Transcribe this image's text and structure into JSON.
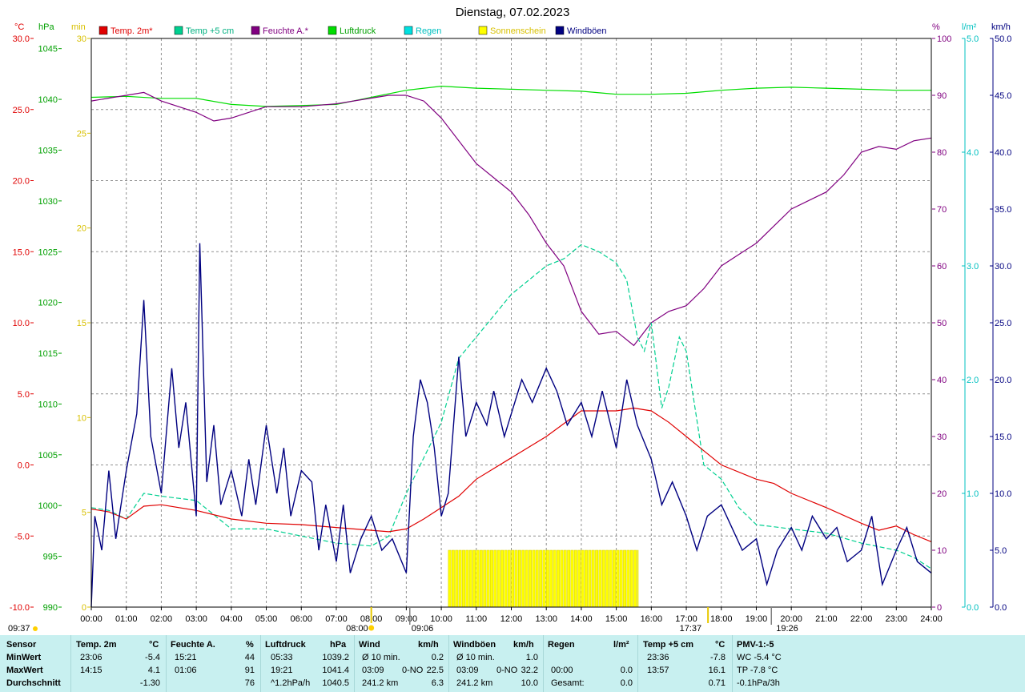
{
  "title": "Dienstag, 07.02.2023",
  "colors": {
    "temp": "#e00000",
    "temp5": "#00d090",
    "humidity": "#800080",
    "pressure": "#00dd00",
    "rain": "#00e0e0",
    "sun": "#ffff00",
    "gust": "#000080",
    "grid": "#808080"
  },
  "legend": [
    {
      "label": "Temp. 2m*",
      "color": "#e00000",
      "text_color": "#e00000"
    },
    {
      "label": "Temp +5 cm",
      "color": "#00d090",
      "text_color": "#00b080"
    },
    {
      "label": "Feuchte A.*",
      "color": "#800080",
      "text_color": "#800080"
    },
    {
      "label": "Luftdruck",
      "color": "#00dd00",
      "text_color": "#00a000"
    },
    {
      "label": "Regen",
      "color": "#00e0e0",
      "text_color": "#00c0c0"
    },
    {
      "label": "Sonnenschein",
      "color": "#ffff00",
      "text_color": "#d8c000"
    },
    {
      "label": "Windböen",
      "color": "#000080",
      "text_color": "#000080"
    }
  ],
  "axis_units": {
    "temp": "°C",
    "pressure": "hPa",
    "sun": "min",
    "humidity": "%",
    "rain": "l/m²",
    "wind": "km/h"
  },
  "chart_data": {
    "type": "line",
    "x_unit": "hours",
    "x_ticks": [
      "00:00",
      "01:00",
      "02:00",
      "03:00",
      "04:00",
      "05:00",
      "06:00",
      "07:00",
      "08:00",
      "09:00",
      "10:00",
      "11:00",
      "12:00",
      "13:00",
      "14:00",
      "15:00",
      "16:00",
      "17:00",
      "18:00",
      "19:00",
      "20:00",
      "21:00",
      "22:00",
      "23:00",
      "24:00"
    ],
    "grid": true,
    "axes": {
      "temp": {
        "ticks": [
          "30.0",
          "25.0",
          "20.0",
          "15.0",
          "10.0",
          "5.0",
          "0.0",
          "-5.0",
          "-10.0"
        ],
        "range": [
          -10,
          30
        ]
      },
      "pressure": {
        "ticks": [
          "1045",
          "1040",
          "1035",
          "1030",
          "1025",
          "1020",
          "1015",
          "1010",
          "1005",
          "1000",
          "995",
          "990"
        ],
        "range": [
          990,
          1046
        ]
      },
      "sun": {
        "ticks": [
          "30",
          "25",
          "20",
          "15",
          "10",
          "5",
          "0"
        ],
        "range": [
          0,
          30
        ]
      },
      "humidity": {
        "ticks": [
          "100",
          "90",
          "80",
          "70",
          "60",
          "50",
          "40",
          "30",
          "20",
          "10",
          "0"
        ],
        "range": [
          0,
          100
        ]
      },
      "rain": {
        "ticks": [
          "5.0",
          "4.0",
          "3.0",
          "2.0",
          "1.0",
          "0.0"
        ],
        "range": [
          0,
          5
        ]
      },
      "wind": {
        "ticks": [
          "50.0",
          "45.0",
          "40.0",
          "35.0",
          "30.0",
          "25.0",
          "20.0",
          "15.0",
          "10.0",
          "5.0",
          "0.0"
        ],
        "range": [
          0,
          50
        ]
      }
    },
    "series": [
      {
        "name": "Temp. 2m*",
        "axis": "temp",
        "x": [
          0,
          0.5,
          1,
          1.5,
          2,
          3,
          4,
          5,
          6,
          7,
          8,
          8.5,
          9,
          9.5,
          10,
          10.5,
          11,
          12,
          13,
          14,
          15,
          15.5,
          16,
          16.5,
          17,
          17.5,
          18,
          19,
          19.5,
          20,
          21,
          22,
          22.5,
          23,
          23.5,
          24
        ],
        "y": [
          -3.1,
          -3.3,
          -3.8,
          -2.9,
          -2.8,
          -3.2,
          -3.8,
          -4.1,
          -4.2,
          -4.4,
          -4.6,
          -4.7,
          -4.5,
          -3.8,
          -3.0,
          -2.2,
          -1.0,
          0.5,
          2.0,
          3.8,
          3.8,
          4.0,
          3.8,
          3.0,
          2.0,
          1.0,
          0.0,
          -1.0,
          -1.3,
          -2.0,
          -3.0,
          -4.1,
          -4.6,
          -4.3,
          -4.9,
          -5.4
        ]
      },
      {
        "name": "Temp +5 cm",
        "axis": "temp",
        "x": [
          0,
          0.5,
          1,
          1.5,
          2,
          3,
          3.5,
          4,
          5,
          6,
          7,
          8,
          8.5,
          9,
          9.5,
          10,
          10.5,
          11,
          12,
          13,
          13.5,
          14,
          14.5,
          15,
          15.3,
          15.6,
          15.8,
          16,
          16.3,
          16.5,
          16.8,
          17,
          17.5,
          18,
          18.5,
          19,
          20,
          21,
          22,
          23,
          23.5,
          24
        ],
        "y": [
          -3.0,
          -3.2,
          -3.8,
          -2.0,
          -2.2,
          -2.5,
          -3.5,
          -4.5,
          -4.5,
          -5.0,
          -5.5,
          -5.7,
          -5.0,
          -2.0,
          0.5,
          3.0,
          7.5,
          9.0,
          12.0,
          14.0,
          14.5,
          15.5,
          15.0,
          14.2,
          13.0,
          9.0,
          8.0,
          10.0,
          4.0,
          5.5,
          9.0,
          8.0,
          0.0,
          -1.0,
          -3.0,
          -4.2,
          -4.5,
          -4.8,
          -5.5,
          -6.0,
          -6.5,
          -7.3
        ]
      },
      {
        "name": "Feuchte A.*",
        "axis": "humidity",
        "x": [
          0,
          0.5,
          1,
          1.5,
          2,
          3,
          3.5,
          4,
          5,
          6,
          7,
          8,
          8.5,
          9,
          9.5,
          10,
          11,
          12,
          12.5,
          13,
          13.5,
          14,
          14.5,
          15,
          15.5,
          16,
          16.5,
          17,
          17.5,
          18,
          18.5,
          19,
          20,
          21,
          21.5,
          22,
          22.5,
          23,
          23.5,
          24
        ],
        "y": [
          89,
          89.5,
          90,
          90.5,
          89,
          87,
          85.5,
          86,
          88,
          88,
          88.5,
          89.5,
          90,
          90,
          89,
          86,
          78,
          73,
          69,
          64,
          60,
          52,
          48,
          48.5,
          46,
          50,
          52,
          53,
          56,
          60,
          62,
          64,
          70,
          73,
          76,
          80,
          81,
          80.5,
          82,
          82.5
        ]
      },
      {
        "name": "Luftdruck",
        "axis": "pressure",
        "x": [
          0,
          1,
          2,
          3,
          4,
          5,
          6,
          7,
          8,
          9,
          10,
          11,
          12,
          13,
          14,
          15,
          16,
          17,
          18,
          19,
          20,
          21,
          22,
          23,
          24
        ],
        "y": [
          1040.2,
          1040.3,
          1040.1,
          1040.1,
          1039.5,
          1039.3,
          1039.4,
          1039.5,
          1040.2,
          1040.9,
          1041.3,
          1041.1,
          1041.0,
          1040.9,
          1040.8,
          1040.5,
          1040.5,
          1040.6,
          1040.9,
          1041.1,
          1041.2,
          1041.1,
          1041.0,
          1040.9,
          1040.9
        ]
      },
      {
        "name": "Windböen",
        "axis": "wind",
        "x": [
          0,
          0.1,
          0.3,
          0.5,
          0.7,
          1,
          1.3,
          1.5,
          1.7,
          2,
          2.3,
          2.5,
          2.7,
          3,
          3.1,
          3.3,
          3.5,
          3.7,
          4,
          4.3,
          4.5,
          4.7,
          5,
          5.3,
          5.5,
          5.7,
          6,
          6.3,
          6.5,
          6.7,
          7,
          7.2,
          7.4,
          7.7,
          8,
          8.3,
          8.6,
          9,
          9.2,
          9.4,
          9.6,
          9.8,
          10,
          10.2,
          10.5,
          10.7,
          11,
          11.3,
          11.5,
          11.8,
          12,
          12.3,
          12.6,
          13,
          13.3,
          13.6,
          14,
          14.3,
          14.6,
          15,
          15.3,
          15.6,
          16,
          16.3,
          16.6,
          17,
          17.3,
          17.6,
          18,
          18.3,
          18.6,
          19,
          19.3,
          19.6,
          20,
          20.3,
          20.6,
          21,
          21.3,
          21.6,
          22,
          22.3,
          22.6,
          23,
          23.3,
          23.6,
          24
        ],
        "y": [
          0,
          8,
          5,
          12,
          6,
          12,
          17,
          27,
          15,
          10,
          21,
          14,
          18,
          8,
          32,
          11,
          16,
          9,
          12,
          8,
          13,
          9,
          16,
          10,
          14,
          8,
          12,
          11,
          5,
          9,
          4,
          9,
          3,
          6,
          8,
          5,
          6,
          3,
          15,
          20,
          18,
          14,
          8,
          10,
          22,
          15,
          18,
          16,
          19,
          15,
          17,
          20,
          18,
          21,
          19,
          16,
          18,
          15,
          19,
          14,
          20,
          16,
          13,
          9,
          11,
          8,
          5,
          8,
          9,
          7,
          5,
          6,
          2,
          5,
          7,
          5,
          8,
          6,
          7,
          4,
          5,
          8,
          2,
          5,
          7,
          4,
          3
        ]
      }
    ],
    "sunshine_blocks": {
      "axis": "sun",
      "x_start": 10.2,
      "x_end": 15.65,
      "value": 3
    },
    "markers": {
      "sunrise": {
        "label": "08:00",
        "x": 8.0
      },
      "sunset": {
        "label": "17:37",
        "x": 17.62
      },
      "moonrise": {
        "label": "09:06",
        "x": 9.1
      },
      "moonset": {
        "label": "19:26",
        "x": 19.43
      },
      "corner": {
        "label": "09:37"
      }
    }
  },
  "stats": {
    "headers": {
      "sensor": "Sensor",
      "temp": "Temp. 2m",
      "temp_u": "°C",
      "hum": "Feuchte A.",
      "hum_u": "%",
      "press": "Luftdruck",
      "press_u": "hPa",
      "wind": "Wind",
      "wind_u": "km/h",
      "gust": "Windböen",
      "gust_u": "km/h",
      "rain": "Regen",
      "rain_u": "l/m²",
      "t5": "Temp +5 cm",
      "t5_u": "°C",
      "pmv": "PMV-1:-5"
    },
    "rows": [
      {
        "label": "MinWert",
        "temp_time": "23:06",
        "temp_val": "-5.4",
        "hum_time": "15:21",
        "hum_val": "44",
        "press_time": "05:33",
        "press_val": "1039.2",
        "wind_a": "Ø 10 min.",
        "wind_b": "",
        "wind_val": "0.2",
        "gust_a": "Ø 10 min.",
        "gust_b": "",
        "gust_val": "1.0",
        "rain_a": "",
        "rain_val": "",
        "t5_time": "23:36",
        "t5_val": "-7.8",
        "pmv": "WC -5.4 °C"
      },
      {
        "label": "MaxWert",
        "temp_time": "14:15",
        "temp_val": "4.1",
        "hum_time": "01:06",
        "hum_val": "91",
        "press_time": "19:21",
        "press_val": "1041.4",
        "wind_a": "03:09",
        "wind_b": "0-NO",
        "wind_val": "22.5",
        "gust_a": "03:09",
        "gust_b": "0-NO",
        "gust_val": "32.2",
        "rain_a": "00:00",
        "rain_val": "0.0",
        "t5_time": "13:57",
        "t5_val": "16.1",
        "pmv": "TP -7.8 °C"
      },
      {
        "label": "Durchschnitt",
        "temp_time": "",
        "temp_val": "-1.30",
        "hum_time": "",
        "hum_val": "76",
        "press_time": "^1.2hPa/h",
        "press_val": "1040.5",
        "wind_a": "241.2 km",
        "wind_b": "",
        "wind_val": "6.3",
        "gust_a": "241.2 km",
        "gust_b": "",
        "gust_val": "10.0",
        "rain_a": "Gesamt:",
        "rain_val": "0.0",
        "t5_time": "",
        "t5_val": "0.71",
        "pmv": "-0.1hPa/3h"
      }
    ]
  }
}
